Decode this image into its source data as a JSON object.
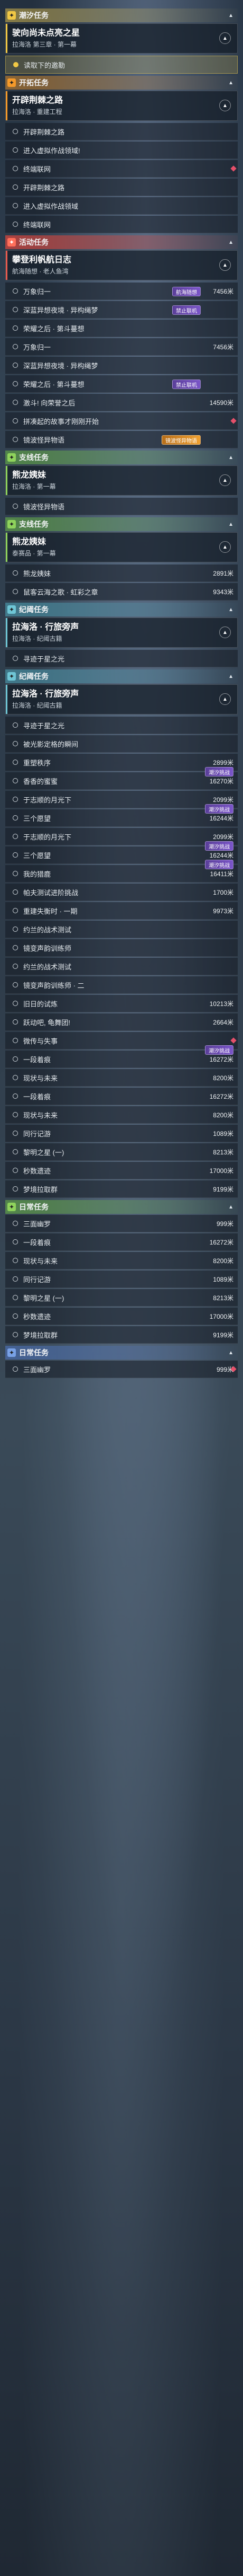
{
  "sections": [
    {
      "type": "main",
      "header": "潮汐任务",
      "card": {
        "title": "驶向尚未点亮之星",
        "sub": "拉海洛 第三章 · 第一幕"
      },
      "objectives": [
        {
          "text": "读取下的邀勒",
          "value": "",
          "highlight": true
        }
      ]
    },
    {
      "type": "open",
      "header": "开拓任务",
      "card": {
        "title": "开辟荆棘之路",
        "sub": "拉海洛 · 重建工程"
      },
      "objectives": [
        {
          "text": "开辟荆棘之路",
          "value": ""
        },
        {
          "text": "进入虚拟作战领域!",
          "value": ""
        },
        {
          "text": "终端联网",
          "value": "",
          "red": true
        }
      ]
    },
    {
      "type": "open",
      "header": "",
      "card": null,
      "objectives": [
        {
          "text": "开辟荆棘之路",
          "value": ""
        },
        {
          "text": "进入虚拟作战领域",
          "value": ""
        },
        {
          "text": "终端联网",
          "value": ""
        }
      ]
    },
    {
      "type": "act",
      "header": "活动任务",
      "card": {
        "title": "攀登利帆航日志",
        "sub": "航海随想 · 老人鱼湾"
      },
      "tags": [
        {
          "label": "航海随想",
          "index": 0
        },
        {
          "label": "禁止联机",
          "index": 1
        }
      ],
      "objectives": [
        {
          "text": "万象归一",
          "value": "7456米"
        },
        {
          "text": "深蓝异想夜境 · 异构绳梦",
          "value": ""
        },
        {
          "text": "荣耀之后 · 第斗蔓想",
          "value": ""
        }
      ]
    },
    {
      "type": "act",
      "header": "",
      "card": null,
      "tags": [
        {
          "label": "禁止联机",
          "index": 2
        }
      ],
      "objectives": [
        {
          "text": "万象归一",
          "value": "7456米"
        },
        {
          "text": "深蓝异想夜境 · 异构绳梦",
          "value": ""
        },
        {
          "text": "荣耀之后 · 第斗蔓想",
          "value": ""
        },
        {
          "text": "激斗! 向荣誉之后",
          "value": "14590米"
        },
        {
          "text": "拼凑起的故事才刚刚开始",
          "value": "",
          "red": true
        },
        {
          "text": "镜波怪异物语",
          "value": ""
        }
      ],
      "tag_orange": "镜波怪异物语"
    },
    {
      "type": "side",
      "header": "支线任务",
      "card": {
        "title": "熊龙姨妹",
        "sub": "拉海洛 · 第一幕"
      },
      "objectives": [
        {
          "text": "镜波怪异物语",
          "value": ""
        }
      ]
    },
    {
      "type": "side",
      "header": "支线任务",
      "card": {
        "title": "熊龙姨妹",
        "sub": "泰赛品 · 第一幕"
      },
      "objectives": [
        {
          "text": "熊龙姨妹",
          "value": "2891米"
        },
        {
          "text": "鼠客云海之歌 · 虹彩之章",
          "value": "9343米"
        }
      ]
    },
    {
      "type": "legend",
      "header": "纪阈任务",
      "card": {
        "title": "拉海洛 · 行旅旁声",
        "sub": "拉海洛 · 纪阈古籍"
      },
      "objectives": [
        {
          "text": "寻迹于星之光",
          "value": ""
        }
      ]
    },
    {
      "type": "legend",
      "header": "纪阈任务",
      "card": {
        "title": "拉海洛 · 行旅旁声",
        "sub": "拉海洛 · 纪阈古籍"
      },
      "objectives": [
        {
          "text": "寻迹于星之光",
          "value": ""
        },
        {
          "text": "被光影定格的瞬间",
          "value": ""
        },
        {
          "text": "重塑秩序",
          "value": "2899米"
        },
        {
          "text": "香香的蜜蜜",
          "value": "16270米"
        },
        {
          "text": "于志顺的月光下",
          "value": "2099米"
        },
        {
          "text": "三个愿望",
          "value": "16244米"
        },
        {
          "text": "于志顺的月光下",
          "value": "2099米"
        },
        {
          "text": "三个愿望",
          "value": "16244米"
        },
        {
          "text": "我的猎鹿",
          "value": "16411米"
        },
        {
          "text": "帕夫测试进阶挑战",
          "value": "1700米"
        },
        {
          "text": "重建失衡时 · 一期",
          "value": "9973米"
        },
        {
          "text": "约兰的战术测试",
          "value": ""
        },
        {
          "text": "镜变声韵训练师",
          "value": ""
        },
        {
          "text": "约兰的战术测试",
          "value": ""
        },
        {
          "text": "镜变声韵训练师 · 二",
          "value": ""
        },
        {
          "text": "旧日的试炼",
          "value": "10213米"
        },
        {
          "text": "跃动吧, 龟舞团!",
          "value": "2664米"
        },
        {
          "text": "微传与失事",
          "value": "",
          "red": true
        },
        {
          "text": "一段着痕",
          "value": "16272米"
        },
        {
          "text": "现状与未来",
          "value": "8200米"
        },
        {
          "text": "一段着痕",
          "value": "16272米"
        },
        {
          "text": "现状与未来",
          "value": "8200米"
        },
        {
          "text": "同行记游",
          "value": "1089米"
        },
        {
          "text": "黎明之星 (一)",
          "value": "8213米"
        },
        {
          "text": "秒数遗迹",
          "value": "17000米"
        },
        {
          "text": "梦境拉取群",
          "value": "9199米"
        }
      ]
    },
    {
      "type": "side",
      "header": "日常任务",
      "card": null,
      "objectives": [
        {
          "text": "三面幽罗",
          "value": "999米"
        },
        {
          "text": "一段着痕",
          "value": "16272米"
        },
        {
          "text": "现状与未来",
          "value": "8200米"
        },
        {
          "text": "同行记游",
          "value": "1089米"
        },
        {
          "text": "黎明之星 (一)",
          "value": "8213米"
        },
        {
          "text": "秒数遗迹",
          "value": "17000米"
        },
        {
          "text": "梦境拉取群",
          "value": "9199米"
        }
      ]
    },
    {
      "type": "daily",
      "header": "日常任务",
      "card": null,
      "objectives": [
        {
          "text": "三面幽罗",
          "value": "999米",
          "red": true
        }
      ]
    }
  ],
  "legend_tags": [
    "潮汐挑战",
    "潮汐挑战",
    "潮汐挑战",
    "潮汐挑战",
    "潮汐挑战"
  ]
}
